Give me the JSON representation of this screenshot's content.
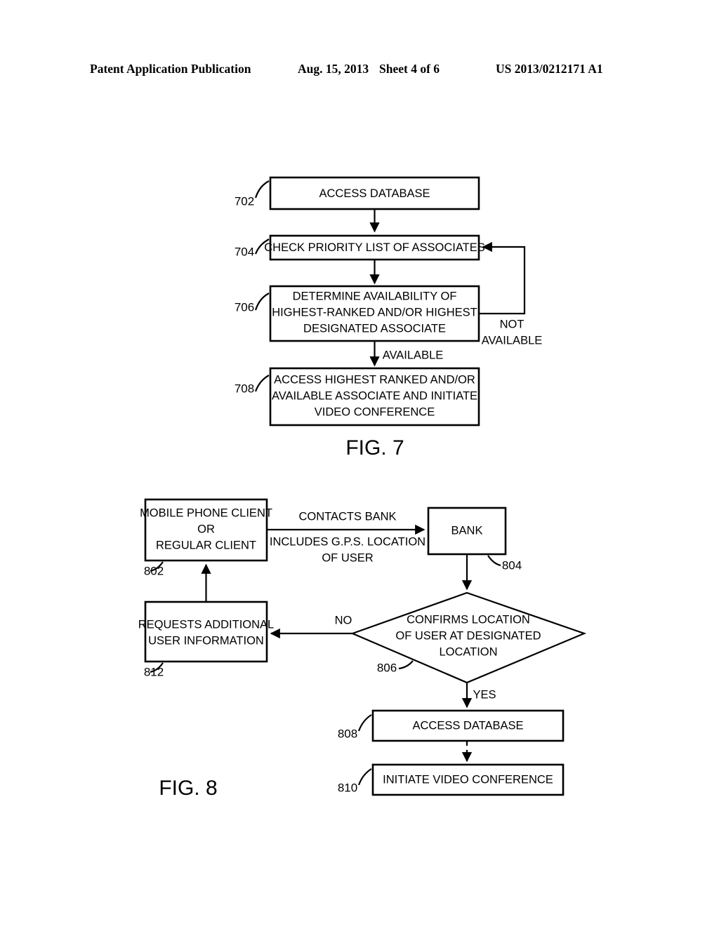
{
  "header": {
    "publication": "Patent Application Publication",
    "date": "Aug. 15, 2013",
    "sheet": "Sheet 4 of 6",
    "patent_number": "US 2013/0212171 A1"
  },
  "figures": [
    {
      "id": "fig7",
      "label": "FIG. 7",
      "nodes": [
        {
          "ref": "702",
          "lines": [
            "ACCESS DATABASE"
          ],
          "shape": "rect"
        },
        {
          "ref": "704",
          "lines": [
            "CHECK PRIORITY LIST OF ASSOCIATES"
          ],
          "shape": "rect"
        },
        {
          "ref": "706",
          "lines": [
            "DETERMINE AVAILABILITY OF",
            "HIGHEST-RANKED AND/OR HIGHEST",
            "DESIGNATED ASSOCIATE"
          ],
          "shape": "rect"
        },
        {
          "ref": "708",
          "lines": [
            "ACCESS HIGHEST RANKED AND/OR",
            "AVAILABLE ASSOCIATE AND INITIATE",
            "VIDEO CONFERENCE"
          ],
          "shape": "rect"
        }
      ],
      "edge_labels": [
        {
          "id": "available",
          "lines": [
            "AVAILABLE"
          ]
        },
        {
          "id": "not-available",
          "lines": [
            "NOT",
            "AVAILABLE"
          ]
        }
      ]
    },
    {
      "id": "fig8",
      "label": "FIG. 8",
      "nodes": [
        {
          "ref": "802",
          "lines": [
            "MOBILE PHONE CLIENT",
            "OR",
            "REGULAR CLIENT"
          ],
          "shape": "rect"
        },
        {
          "ref": "804",
          "lines": [
            "BANK"
          ],
          "shape": "rect"
        },
        {
          "ref": "806",
          "lines": [
            "CONFIRMS LOCATION",
            "OF USER AT DESIGNATED",
            "LOCATION"
          ],
          "shape": "diamond"
        },
        {
          "ref": "808",
          "lines": [
            "ACCESS DATABASE"
          ],
          "shape": "rect"
        },
        {
          "ref": "810",
          "lines": [
            "INITIATE VIDEO CONFERENCE"
          ],
          "shape": "rect"
        },
        {
          "ref": "812",
          "lines": [
            "REQUESTS ADDITIONAL",
            "USER INFORMATION"
          ],
          "shape": "rect"
        }
      ],
      "edge_labels": [
        {
          "id": "contacts-bank",
          "lines": [
            "CONTACTS BANK",
            "INCLUDES G.P.S. LOCATION",
            "OF USER"
          ]
        },
        {
          "id": "no",
          "lines": [
            "NO"
          ]
        },
        {
          "id": "yes",
          "lines": [
            "YES"
          ]
        }
      ]
    }
  ],
  "text": {
    "fig7_702_l1": "ACCESS DATABASE",
    "fig7_704_l1": "CHECK PRIORITY LIST OF ASSOCIATES",
    "fig7_706_l1": "DETERMINE AVAILABILITY OF",
    "fig7_706_l2": "HIGHEST-RANKED AND/OR HIGHEST",
    "fig7_706_l3": "DESIGNATED ASSOCIATE",
    "fig7_708_l1": "ACCESS HIGHEST RANKED AND/OR",
    "fig7_708_l2": "AVAILABLE ASSOCIATE AND INITIATE",
    "fig7_708_l3": "VIDEO CONFERENCE",
    "fig7_ref_702": "702",
    "fig7_ref_704": "704",
    "fig7_ref_706": "706",
    "fig7_ref_708": "708",
    "fig7_lbl_available": "AVAILABLE",
    "fig7_lbl_not": "NOT",
    "fig7_lbl_notavail": "AVAILABLE",
    "fig7_caption": "FIG. 7",
    "fig8_802_l1": "MOBILE PHONE CLIENT",
    "fig8_802_l2": "OR",
    "fig8_802_l3": "REGULAR CLIENT",
    "fig8_804_l1": "BANK",
    "fig8_806_l1": "CONFIRMS LOCATION",
    "fig8_806_l2": "OF USER AT DESIGNATED",
    "fig8_806_l3": "LOCATION",
    "fig8_808_l1": "ACCESS DATABASE",
    "fig8_810_l1": "INITIATE VIDEO CONFERENCE",
    "fig8_812_l1": "REQUESTS ADDITIONAL",
    "fig8_812_l2": "USER INFORMATION",
    "fig8_ref_802": "802",
    "fig8_ref_804": "804",
    "fig8_ref_806": "806",
    "fig8_ref_808": "808",
    "fig8_ref_810": "810",
    "fig8_ref_812": "812",
    "fig8_lbl_contacts": "CONTACTS BANK",
    "fig8_lbl_includes": "INCLUDES G.P.S. LOCATION",
    "fig8_lbl_ofuser": "OF USER",
    "fig8_lbl_no": "NO",
    "fig8_lbl_yes": "YES",
    "fig8_caption": "FIG. 8"
  },
  "colors": {
    "ink": "#000000",
    "paper": "#ffffff"
  }
}
